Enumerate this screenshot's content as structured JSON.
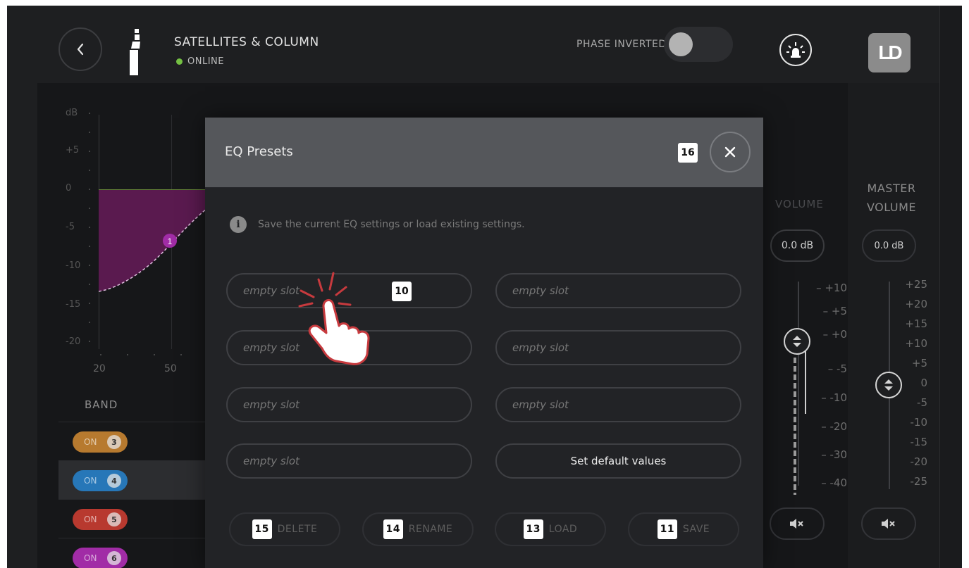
{
  "header": {
    "device_name": "SATELLITES & COLUMN",
    "status": "ONLINE",
    "phase_label": "PHASE INVERTED",
    "logo_text": "LD"
  },
  "eq_graph": {
    "db_labels": [
      "dB",
      "+5",
      "0",
      "-5",
      "-10",
      "-15",
      "-20"
    ],
    "freq_labels": [
      "20",
      "50"
    ],
    "band_marker": "1",
    "band_header": "BAND"
  },
  "bands": [
    {
      "state": "ON",
      "number": "3",
      "color": "#b77a2f"
    },
    {
      "state": "ON",
      "number": "4",
      "color": "#2777b8",
      "selected": true
    },
    {
      "state": "ON",
      "number": "5",
      "color": "#b8392f"
    },
    {
      "state": "ON",
      "number": "6",
      "color": "#a12ca6"
    }
  ],
  "volume": {
    "label": "VOLUME",
    "value": "0.0 dB",
    "scale": [
      "+10",
      "+5",
      "+0",
      "-5",
      "-10",
      "-20",
      "-30",
      "-40"
    ]
  },
  "master_volume": {
    "label_line1": "MASTER",
    "label_line2": "VOLUME",
    "value": "0.0 dB",
    "scale": [
      "+25",
      "+20",
      "+15",
      "+10",
      "+5",
      "0",
      "-5",
      "-10",
      "-15",
      "-20",
      "-25"
    ]
  },
  "modal": {
    "title": "EQ Presets",
    "close_badge": "16",
    "info_text": "Save the current EQ settings or load existing settings.",
    "slots": [
      "empty slot",
      "empty slot",
      "empty slot",
      "empty slot",
      "empty slot",
      "empty slot",
      "empty slot"
    ],
    "default_button": "Set default values",
    "slot_badge": "10",
    "actions": [
      {
        "badge": "15",
        "label": "DELETE"
      },
      {
        "badge": "14",
        "label": "RENAME"
      },
      {
        "badge": "13",
        "label": "LOAD"
      },
      {
        "badge": "11",
        "label": "SAVE"
      }
    ]
  },
  "colors": {
    "eq_fill": "#5a1a4f",
    "status_online": "#74c043"
  }
}
